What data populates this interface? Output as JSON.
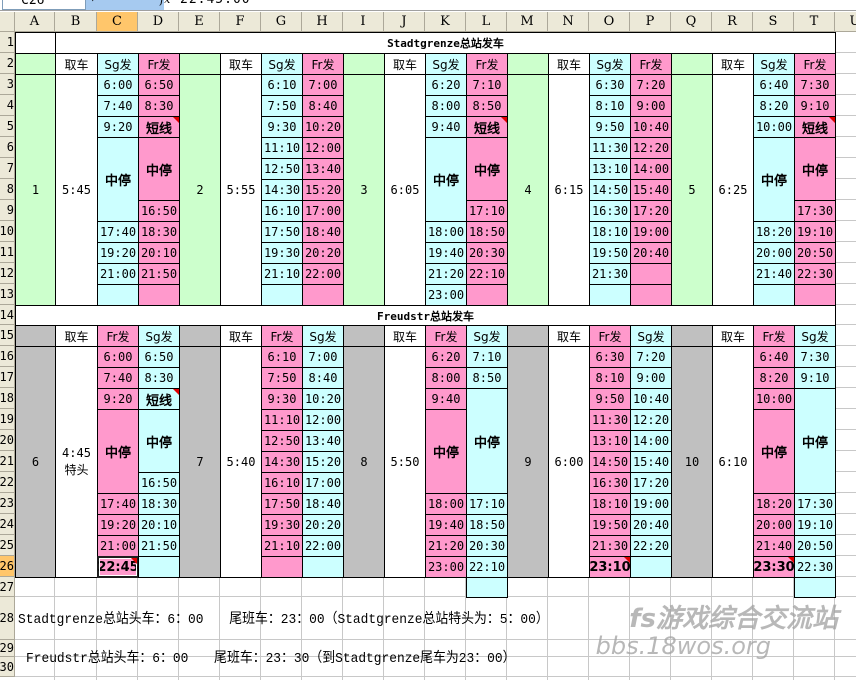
{
  "formula_bar": {
    "name_box": "C26",
    "fx": "fx",
    "value": "22:45:00"
  },
  "columns": [
    "A",
    "B",
    "C",
    "D",
    "E",
    "F",
    "G",
    "H",
    "I",
    "J",
    "K",
    "L",
    "M",
    "N",
    "O",
    "P",
    "Q",
    "R",
    "S",
    "T",
    "U"
  ],
  "selected_column": "C",
  "selected_row": "26",
  "rows": [
    "1",
    "2",
    "3",
    "4",
    "5",
    "6",
    "7",
    "8",
    "9",
    "10",
    "11",
    "12",
    "13",
    "14",
    "15",
    "16",
    "17",
    "18",
    "19",
    "20",
    "21",
    "22",
    "23",
    "24",
    "25",
    "26",
    "27",
    "28",
    "29",
    "30"
  ],
  "colors": {
    "sg": "#ccffff",
    "fr": "#ff99cc",
    "bus_top": "#ccffcc",
    "bus_bottom": "#c0c0c0",
    "comment_marker": "#e00000"
  },
  "sections": [
    {
      "title": "Stadtgrenze总站发车",
      "header": {
        "pickup": "取车",
        "col1": "Sg发",
        "col2": "Fr发"
      },
      "col1_color": "sg",
      "col2_color": "fr",
      "bus_color": "bus_top",
      "blocks": [
        {
          "bus": "1",
          "pickup": "5:45",
          "col1": [
            "6:00",
            "7:40",
            "9:20",
            {
              "t": "中停",
              "span": 4,
              "bold": true
            },
            "17:40",
            "19:20",
            "21:00",
            ""
          ],
          "col2": [
            "6:50",
            "8:30",
            {
              "t": "短线",
              "bold": true,
              "comment": true
            },
            {
              "t": "中停",
              "span": 3,
              "bold": true
            },
            "16:50",
            "18:30",
            "20:10",
            "21:50",
            ""
          ]
        },
        {
          "bus": "2",
          "pickup": "5:55",
          "col1": [
            "6:10",
            "7:50",
            "9:30",
            "11:10",
            "12:50",
            "14:30",
            "16:10",
            "17:50",
            "19:30",
            "21:10",
            ""
          ],
          "col2": [
            "7:00",
            "8:40",
            "10:20",
            "12:00",
            "13:40",
            "15:20",
            "17:00",
            "18:40",
            "20:20",
            "22:00",
            ""
          ]
        },
        {
          "bus": "3",
          "pickup": "6:05",
          "col1": [
            "6:20",
            "8:00",
            "9:40",
            {
              "t": "中停",
              "span": 4,
              "bold": true
            },
            "18:00",
            "19:40",
            "21:20",
            "23:00"
          ],
          "col2": [
            "7:10",
            "8:50",
            {
              "t": "短线",
              "bold": true,
              "comment": true
            },
            {
              "t": "中停",
              "span": 3,
              "bold": true
            },
            "17:10",
            "18:50",
            "20:30",
            "22:10",
            ""
          ]
        },
        {
          "bus": "4",
          "pickup": "6:15",
          "col1": [
            "6:30",
            "8:10",
            "9:50",
            "11:30",
            "13:10",
            "14:50",
            "16:30",
            "18:10",
            "19:50",
            "21:30",
            ""
          ],
          "col2": [
            "7:20",
            "9:00",
            "10:40",
            "12:20",
            "14:00",
            "15:40",
            "17:20",
            "19:00",
            "20:40",
            "",
            ""
          ]
        },
        {
          "bus": "5",
          "pickup": "6:25",
          "col1": [
            "6:40",
            "8:20",
            "10:00",
            {
              "t": "中停",
              "span": 4,
              "bold": true
            },
            "18:20",
            "20:00",
            "21:40",
            ""
          ],
          "col2": [
            "7:30",
            "9:10",
            {
              "t": "短线",
              "bold": true,
              "comment": true
            },
            {
              "t": "中停",
              "span": 3,
              "bold": true
            },
            "17:30",
            "19:10",
            "20:50",
            "22:30",
            ""
          ]
        }
      ]
    },
    {
      "title": "Freudstr总站发车",
      "header": {
        "pickup": "取车",
        "col1": "Fr发",
        "col2": "Sg发"
      },
      "col1_color": "fr",
      "col2_color": "sg",
      "bus_color": "bus_bottom",
      "blocks": [
        {
          "bus": "6",
          "pickup": "4:45特头",
          "col1": [
            "6:00",
            "7:40",
            "9:20",
            {
              "t": "中停",
              "span": 4,
              "bold": true
            },
            "17:40",
            "19:20",
            "21:00",
            {
              "t": "22:45",
              "bold": true,
              "comment": true,
              "selected": true
            }
          ],
          "col2": [
            "6:50",
            "8:30",
            {
              "t": "短线",
              "bold": true,
              "comment": true
            },
            {
              "t": "中停",
              "span": 3,
              "bold": true
            },
            "16:50",
            "18:30",
            "20:10",
            "21:50",
            ""
          ]
        },
        {
          "bus": "7",
          "pickup": "5:40",
          "col1": [
            "6:10",
            "7:50",
            "9:30",
            "11:10",
            "12:50",
            "14:30",
            "16:10",
            "17:50",
            "19:30",
            "21:10",
            ""
          ],
          "col2": [
            "7:00",
            "8:40",
            "10:20",
            "12:00",
            "13:40",
            "15:20",
            "17:00",
            "18:40",
            "20:20",
            "22:00",
            ""
          ]
        },
        {
          "bus": "8",
          "pickup": "5:50",
          "col1": [
            "6:20",
            "8:00",
            "9:40",
            {
              "t": "中停",
              "span": 4,
              "bold": true
            },
            "18:00",
            "19:40",
            "21:20",
            "23:00"
          ],
          "col2": [
            "7:10",
            "8:50",
            {
              "t": "中停",
              "span": 5,
              "bold": true
            },
            "17:10",
            "18:50",
            "20:30",
            "22:10",
            ""
          ]
        },
        {
          "bus": "9",
          "pickup": "6:00",
          "col1": [
            "6:30",
            "8:10",
            "9:50",
            "11:30",
            "13:10",
            "14:50",
            "16:30",
            "18:10",
            "19:50",
            "21:30",
            {
              "t": "23:10",
              "bold": true,
              "comment": true
            }
          ],
          "col2": [
            "7:20",
            "9:00",
            "10:40",
            "12:20",
            "14:00",
            "15:40",
            "17:20",
            "19:00",
            "20:40",
            "22:20",
            ""
          ]
        },
        {
          "bus": "10",
          "pickup": "6:10",
          "col1": [
            "6:40",
            "8:20",
            "10:00",
            {
              "t": "中停",
              "span": 4,
              "bold": true
            },
            "18:20",
            "20:00",
            "21:40",
            {
              "t": "23:30",
              "bold": true,
              "comment": true
            }
          ],
          "col2": [
            "7:30",
            "9:10",
            {
              "t": "中停",
              "span": 5,
              "bold": true
            },
            "17:30",
            "19:10",
            "20:50",
            "22:30",
            ""
          ]
        }
      ]
    }
  ],
  "notes": [
    "Stadtgrenze总站头车：6：00　　尾班车：23：00（Stadtgrenze总站特头为：5：00）",
    "Freudstr总站头车：6：00　　尾班车：23：30（到Stadtgrenze尾车为23：00）"
  ],
  "watermark": {
    "line1": "fs游戏综合交流站",
    "line2": "bbs.18wos.org"
  }
}
